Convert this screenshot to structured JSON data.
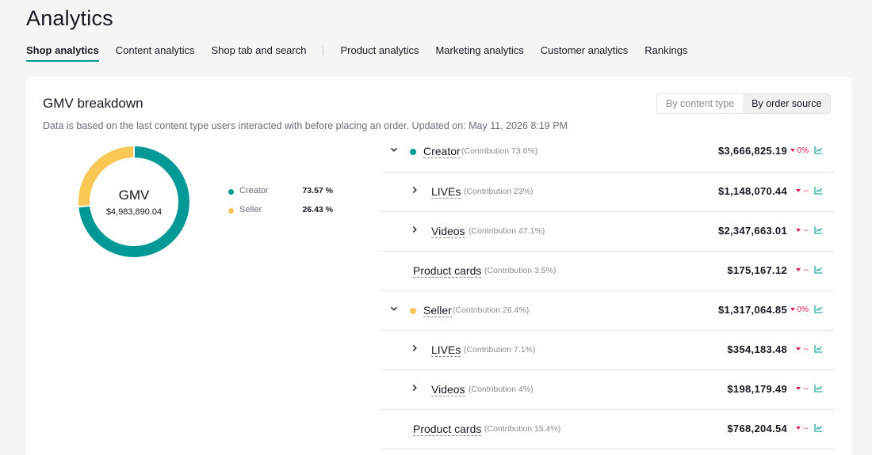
{
  "page": {
    "title": "Analytics"
  },
  "tabs": [
    {
      "label": "Shop analytics",
      "active": true
    },
    {
      "label": "Content analytics"
    },
    {
      "label": "Shop tab and search"
    },
    {
      "label": "Product analytics"
    },
    {
      "label": "Marketing analytics"
    },
    {
      "label": "Customer analytics"
    },
    {
      "label": "Rankings"
    }
  ],
  "card": {
    "title": "GMV breakdown",
    "subtitle": "Data is based on the last content type users interacted with before placing an order.  Updated on: May 11, 2026 8:19 PM",
    "toggle": {
      "option_1": "By content type",
      "option_2": "By order source",
      "selected": "By order source"
    }
  },
  "donut": {
    "label": "GMV",
    "value": "$4,983,890.04",
    "segments": [
      {
        "name": "Creator",
        "pct_label": "73.57 %",
        "fraction": 0.7357,
        "color": "#009995"
      },
      {
        "name": "Seller",
        "pct_label": "26.43 %",
        "fraction": 0.2643,
        "color": "#fac654"
      }
    ]
  },
  "breakdown": [
    {
      "name": "Creator",
      "contribution": "(Contribution 73.6%)",
      "amount": "$3,666,825.19",
      "change": "0%",
      "level": 0,
      "expanded": true,
      "color": "#009995"
    },
    {
      "name": "LIVEs",
      "contribution": "(Contribution 23%)",
      "amount": "$1,148,070.44",
      "change": "--",
      "level": 1,
      "expandable": true
    },
    {
      "name": "Videos",
      "contribution": "(Contribution 47.1%)",
      "amount": "$2,347,663.01",
      "change": "--",
      "level": 1,
      "expandable": true
    },
    {
      "name": "Product cards",
      "contribution": "(Contribution 3.5%)",
      "amount": "$175,167.12",
      "change": "--",
      "level": 1,
      "expandable": false
    },
    {
      "name": "Seller",
      "contribution": "(Contribution 26.4%)",
      "amount": "$1,317,064.85",
      "change": "0%",
      "level": 0,
      "expanded": true,
      "color": "#fac654"
    },
    {
      "name": "LIVEs",
      "contribution": "(Contribution 7.1%)",
      "amount": "$354,183.48",
      "change": "--",
      "level": 1,
      "expandable": true
    },
    {
      "name": "Videos",
      "contribution": "(Contribution 4%)",
      "amount": "$198,179.49",
      "change": "--",
      "level": 1,
      "expandable": true
    },
    {
      "name": "Product cards",
      "contribution": "(Contribution 15.4%)",
      "amount": "$768,204.54",
      "change": "--",
      "level": 1,
      "expandable": false
    }
  ],
  "icons": {
    "trend": "trend-chart-icon",
    "expand": "chevron-icon",
    "decrease": "triangle-down-icon"
  },
  "colors": {
    "accent": "#009995",
    "seller": "#fac654",
    "negative": "#e0194f"
  }
}
